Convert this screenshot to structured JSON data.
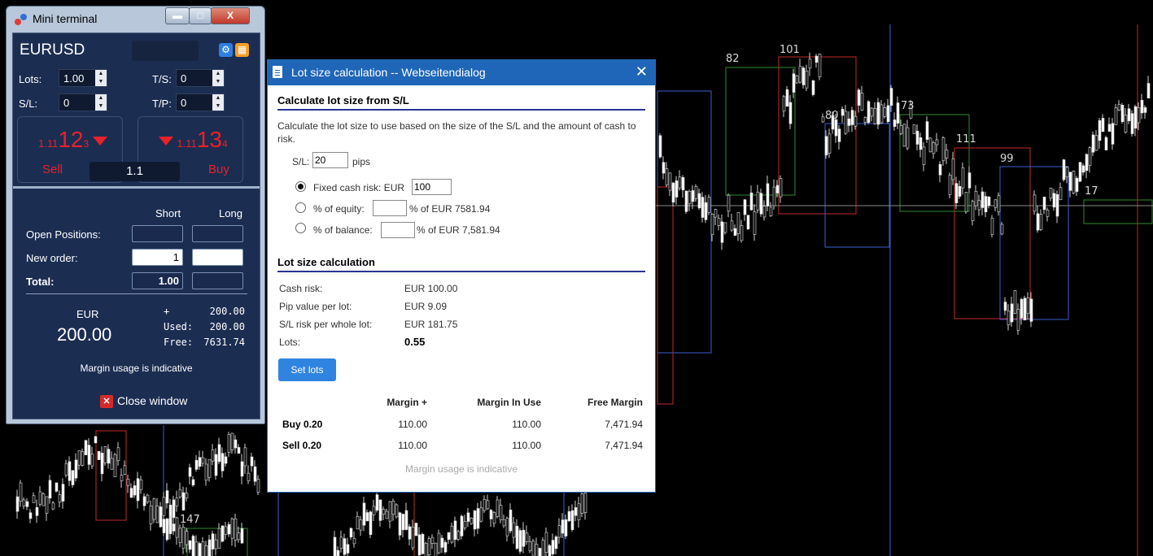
{
  "chart": {
    "labels": [
      "82",
      "101",
      "80",
      "73",
      "111",
      "99",
      "17",
      "147"
    ]
  },
  "mini_terminal": {
    "title": "Mini terminal",
    "window_buttons": {
      "minimize": "▬",
      "maximize": "□",
      "close": "X"
    },
    "symbol": "EURUSD",
    "lots_label": "Lots:",
    "lots_value": "1.00",
    "ts_label": "T/S:",
    "ts_value": "0",
    "sl_label": "S/L:",
    "sl_value": "0",
    "tp_label": "T/P:",
    "tp_value": "0",
    "sell": {
      "price_small": "1.11",
      "price_big": "12",
      "price_pip": "3",
      "label": "Sell"
    },
    "buy": {
      "price_small": "1.11",
      "price_big": "13",
      "price_pip": "4",
      "label": "Buy"
    },
    "spread": "1.1",
    "col_short": "Short",
    "col_long": "Long",
    "open_positions_label": "Open Positions:",
    "new_order_label": "New order:",
    "new_order_short": "1",
    "total_label": "Total:",
    "total_short": "1.00",
    "currency": "EUR",
    "margin_amount": "200.00",
    "plus_label": "+",
    "plus_value": "200.00",
    "used_label": "Used:",
    "used_value": "200.00",
    "free_label": "Free:",
    "free_value": "7631.74",
    "margin_note": "Margin usage is indicative",
    "close_window": "Close window"
  },
  "dialog": {
    "title": "Lot size calculation -- Webseitendialog",
    "close": "✕",
    "section1": "Calculate lot size from S/L",
    "description": "Calculate the lot size to use based on the size of the S/L and the amount of cash to risk.",
    "sl_label": "S/L:",
    "sl_value": "20",
    "pips_label": "pips",
    "fixed_label": "Fixed cash risk: EUR",
    "fixed_value": "100",
    "equity_label": "% of equity:",
    "equity_suffix": "% of EUR 7581.94",
    "balance_label": "% of balance:",
    "balance_suffix": "% of EUR 7,581.94",
    "section2": "Lot size calculation",
    "rows": [
      {
        "label": "Cash risk:",
        "value": "EUR 100.00"
      },
      {
        "label": "Pip value per lot:",
        "value": "EUR 9.09"
      },
      {
        "label": "S/L risk per whole lot:",
        "value": "EUR 181.75"
      },
      {
        "label": "Lots:",
        "value": "0.55"
      }
    ],
    "set_lots": "Set lots",
    "table_headers": [
      "Margin +",
      "Margin In Use",
      "Free Margin"
    ],
    "table_rows": [
      {
        "label": "Buy 0.20",
        "margin_plus": "110.00",
        "margin_in_use": "110.00",
        "free_margin": "7,471.94"
      },
      {
        "label": "Sell 0.20",
        "margin_plus": "110.00",
        "margin_in_use": "110.00",
        "free_margin": "7,471.94"
      }
    ],
    "note": "Margin usage is indicative"
  }
}
